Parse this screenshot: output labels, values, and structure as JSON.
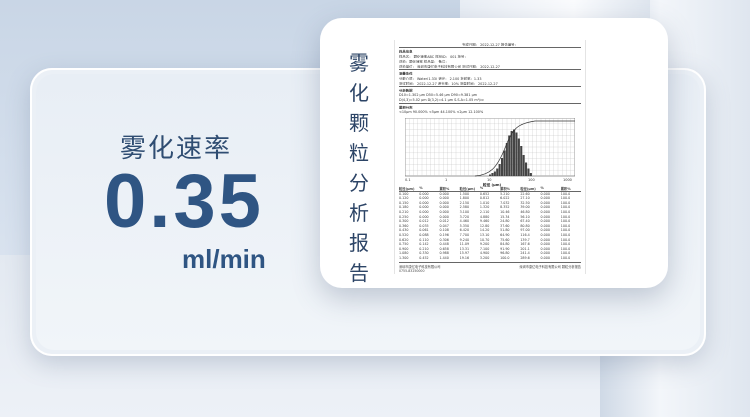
{
  "metric": {
    "label": "雾化速率",
    "value": "0.35",
    "unit": "ml/min"
  },
  "report": {
    "title_chars": [
      "雾",
      "化",
      "颗",
      "粒",
      "分",
      "析",
      "报",
      "告"
    ],
    "document": {
      "date_line": "完成日期： 2022-12-27        报告编号：",
      "sections": [
        "样品信息",
        "测量条件",
        "分析数据",
        "累积分布"
      ],
      "rows": [
        "样品名： 颗化速率ABC       样品ID： 001              批号：",
        "送检：颗化速率              样品量：                  备注：",
        "送检单位： 深圳市康亿电子科技有限公司  测试日期： 2022-12-27",
        "分散介质： Water(1.33)       遮光： 2.100           折射率：1.33",
        "测试时间： 2022-12-27      遮光率：10%        测量时间： 2022-12-27",
        "D10=1.302 μm      D50=5.46 μm      D90=9.381 μm",
        "D(4,3)=5.02 μm    D(3,2)=4.1 μm    S.S.A=1.05 m²/cc",
        "<10μm 90.000%     <5μm 44.100%     <2μm 12.100%"
      ],
      "histogram_x_label": "粒径 (μm)",
      "histogram_ticks": [
        "0.1",
        "1",
        "10",
        "100",
        "1000"
      ],
      "table_headers": [
        "粒径(μm)",
        "%",
        "累积%",
        "粒径(μm)",
        "%",
        "累积%",
        "粒径(μm)",
        "%",
        "累积%"
      ],
      "table_rows": [
        [
          "0.100",
          "0.000",
          "0.000",
          "1.500",
          "0.652",
          "5.210",
          "22.60",
          "0.000",
          "100.0"
        ],
        [
          "0.120",
          "0.000",
          "0.000",
          "1.800",
          "0.812",
          "6.022",
          "27.10",
          "0.000",
          "100.0"
        ],
        [
          "0.150",
          "0.000",
          "0.000",
          "2.150",
          "1.010",
          "7.032",
          "32.50",
          "0.000",
          "100.0"
        ],
        [
          "0.180",
          "0.000",
          "0.000",
          "2.580",
          "1.320",
          "8.352",
          "39.00",
          "0.000",
          "100.0"
        ],
        [
          "0.210",
          "0.000",
          "0.000",
          "3.100",
          "2.110",
          "10.46",
          "46.80",
          "0.000",
          "100.0"
        ],
        [
          "0.250",
          "0.000",
          "0.000",
          "3.720",
          "4.880",
          "15.34",
          "56.10",
          "0.000",
          "100.0"
        ],
        [
          "0.300",
          "0.012",
          "0.012",
          "4.460",
          "9.460",
          "24.80",
          "67.40",
          "0.000",
          "100.0"
        ],
        [
          "0.360",
          "0.035",
          "0.047",
          "5.350",
          "12.80",
          "37.60",
          "80.80",
          "0.000",
          "100.0"
        ],
        [
          "0.430",
          "0.061",
          "0.108",
          "6.420",
          "14.20",
          "51.80",
          "97.00",
          "0.000",
          "100.0"
        ],
        [
          "0.520",
          "0.088",
          "0.196",
          "7.700",
          "13.10",
          "64.90",
          "116.4",
          "0.000",
          "100.0"
        ],
        [
          "0.620",
          "0.110",
          "0.306",
          "9.240",
          "10.70",
          "75.60",
          "139.7",
          "0.000",
          "100.0"
        ],
        [
          "0.750",
          "0.142",
          "0.448",
          "11.09",
          "9.200",
          "84.80",
          "167.6",
          "0.000",
          "100.0"
        ],
        [
          "0.900",
          "0.210",
          "0.658",
          "13.31",
          "7.100",
          "91.90",
          "201.1",
          "0.000",
          "100.0"
        ],
        [
          "1.080",
          "0.330",
          "0.988",
          "15.97",
          "4.900",
          "96.80",
          "241.4",
          "0.000",
          "100.0"
        ],
        [
          "1.300",
          "0.452",
          "1.440",
          "19.16",
          "3.200",
          "100.0",
          "289.6",
          "0.000",
          "100.0"
        ]
      ],
      "footer_left": "深圳市康亿电子科技有限公司",
      "footer_right": "深圳市康亿电子科技有限公司 颗粒分析报告",
      "footer_phone": "0755-83250000"
    }
  }
}
